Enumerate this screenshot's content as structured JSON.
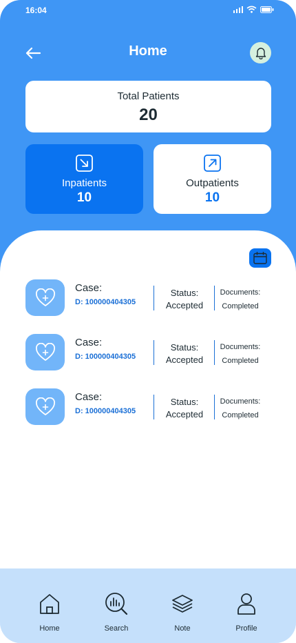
{
  "status_bar": {
    "time": "16:04"
  },
  "header": {
    "title": "Home"
  },
  "summary": {
    "total_label": "Total Patients",
    "total_value": "20",
    "inpatients_label": "Inpatients",
    "inpatients_value": "10",
    "outpatients_label": "Outpatients",
    "outpatients_value": "10"
  },
  "cases": [
    {
      "title": "Case:",
      "id": "D: 100000404305",
      "status_label": "Status:",
      "status_value": "Accepted",
      "docs_label": "Documents:",
      "docs_value": "Completed"
    },
    {
      "title": "Case:",
      "id": "D: 100000404305",
      "status_label": "Status:",
      "status_value": "Accepted",
      "docs_label": "Documents:",
      "docs_value": "Completed"
    },
    {
      "title": "Case:",
      "id": "D: 100000404305",
      "status_label": "Status:",
      "status_value": "Accepted",
      "docs_label": "Documents:",
      "docs_value": "Completed"
    }
  ],
  "tab_bar": {
    "items": [
      {
        "label": "Home",
        "icon": "home-icon"
      },
      {
        "label": "Search",
        "icon": "search-chart-icon"
      },
      {
        "label": "Note",
        "icon": "layers-icon"
      },
      {
        "label": "Profile",
        "icon": "user-icon"
      }
    ]
  },
  "colors": {
    "primary": "#3f96f5",
    "accent": "#0a73f0",
    "tab_bar": "#c5e0fb",
    "bell_bg": "#d5f0df"
  }
}
